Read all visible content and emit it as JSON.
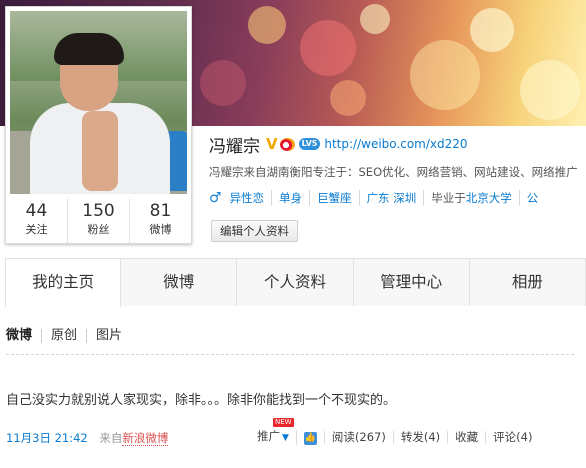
{
  "profile": {
    "name": "冯耀宗",
    "verified_mark": "V",
    "level_badge": "LV5",
    "link": "http://weibo.com/xd220",
    "bio": "冯耀宗来自湖南衡阳专注于：SEO优化、网络营销、网站建设、网络推广",
    "tags": {
      "orientation": "异性恋",
      "relationship": "单身",
      "zodiac": "巨蟹座",
      "province": "广东",
      "city": "深圳",
      "school_prefix": "毕业于",
      "school": "北京大学",
      "extra": "公"
    },
    "edit_button": "编辑个人资料",
    "stats": [
      {
        "num": "44",
        "label": "关注"
      },
      {
        "num": "150",
        "label": "粉丝"
      },
      {
        "num": "81",
        "label": "微博"
      }
    ]
  },
  "tabs": [
    "我的主页",
    "微博",
    "个人资料",
    "管理中心",
    "相册"
  ],
  "subnav": [
    "微博",
    "原创",
    "图片"
  ],
  "post": {
    "text": "自己没实力就别说人家现实，除非。。。除非你能找到一个不现实的。",
    "time": "11月3日 21:42",
    "source_prefix": "来自",
    "source": "新浪微博",
    "promote": "推广",
    "new_badge": "NEW",
    "read": "阅读(267)",
    "repost": "转发(4)",
    "favorite": "收藏",
    "comment": "评论(4)"
  },
  "colors": {
    "link": "#0a7bd0",
    "vip": "#f0a800",
    "source": "#d9534f"
  }
}
